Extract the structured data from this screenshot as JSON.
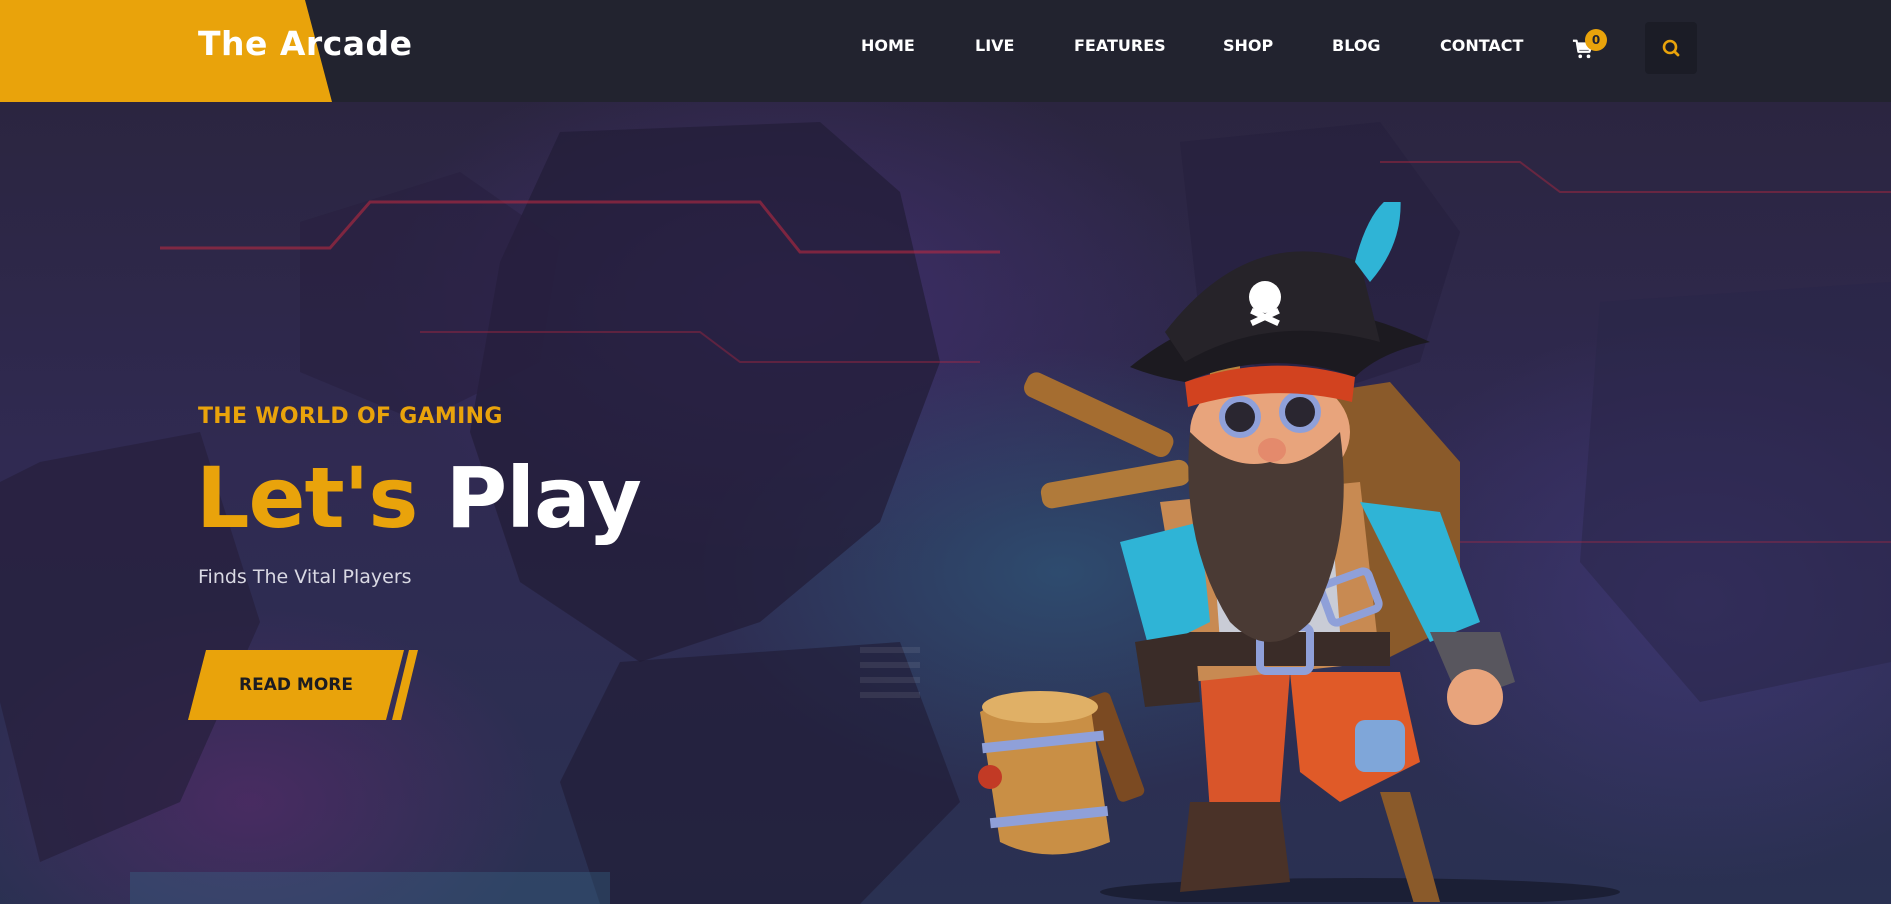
{
  "brand": {
    "name": "The Arcade"
  },
  "nav": {
    "items": [
      {
        "label": "HOME"
      },
      {
        "label": "LIVE"
      },
      {
        "label": "FEATURES"
      },
      {
        "label": "SHOP"
      },
      {
        "label": "BLOG"
      },
      {
        "label": "CONTACT"
      }
    ]
  },
  "cart": {
    "count": "0",
    "icon": "cart-icon"
  },
  "search": {
    "icon": "search-icon"
  },
  "hero": {
    "eyebrow": "THE WORLD OF GAMING",
    "headline_word1": "Let's",
    "headline_word2": "Play",
    "tagline": "Finds The Vital Players",
    "cta_label": "READ MORE",
    "illustration": "pirate-dwarf-character"
  },
  "colors": {
    "accent": "#e9a30b",
    "header_bg": "#22232f",
    "text_light": "#ffffff"
  }
}
